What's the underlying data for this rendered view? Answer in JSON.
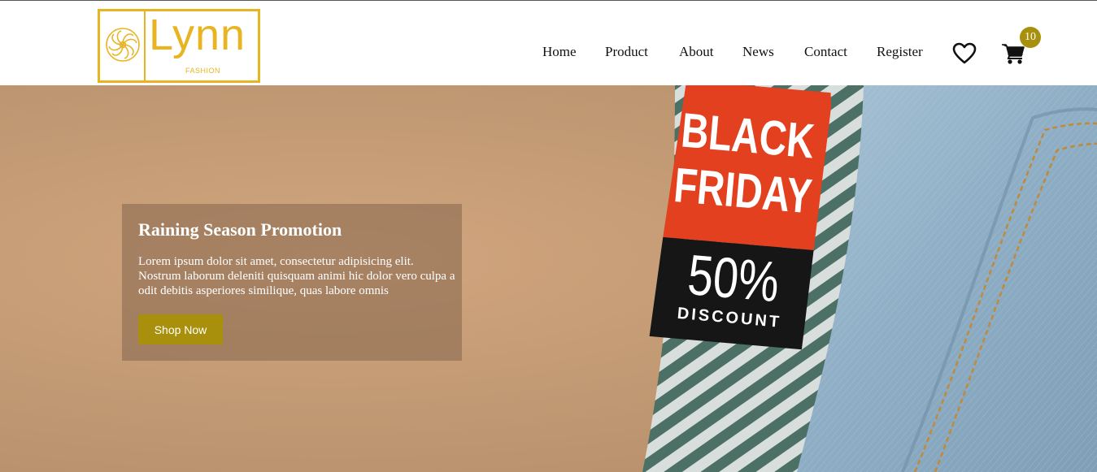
{
  "brand": {
    "name": "Lynn",
    "tagline": "FASHION",
    "color": "#e8b422"
  },
  "nav": {
    "items": [
      {
        "label": "Home"
      },
      {
        "label": "Product"
      },
      {
        "label": "About"
      },
      {
        "label": "News"
      },
      {
        "label": "Contact"
      },
      {
        "label": "Register"
      }
    ]
  },
  "header_icons": {
    "wishlist_icon": "heart-icon",
    "cart_icon": "cart-icon",
    "cart_count": "10",
    "badge_color": "#a8900d"
  },
  "hero": {
    "tag": {
      "line1": "BLACK",
      "line2": "FRIDAY",
      "discount": "50%",
      "discount_label": "DISCOUNT",
      "red": "#e2401f",
      "black": "#161616"
    },
    "promo": {
      "title": "Raining Season Promotion",
      "body": "Lorem ipsum dolor sit amet, consectetur adipisicing elit. Nostrum laborum deleniti quisquam animi hic dolor vero culpa a odit debitis asperiores similique, quas labore omnis",
      "button_label": "Shop Now",
      "button_color": "#a8900d"
    }
  }
}
